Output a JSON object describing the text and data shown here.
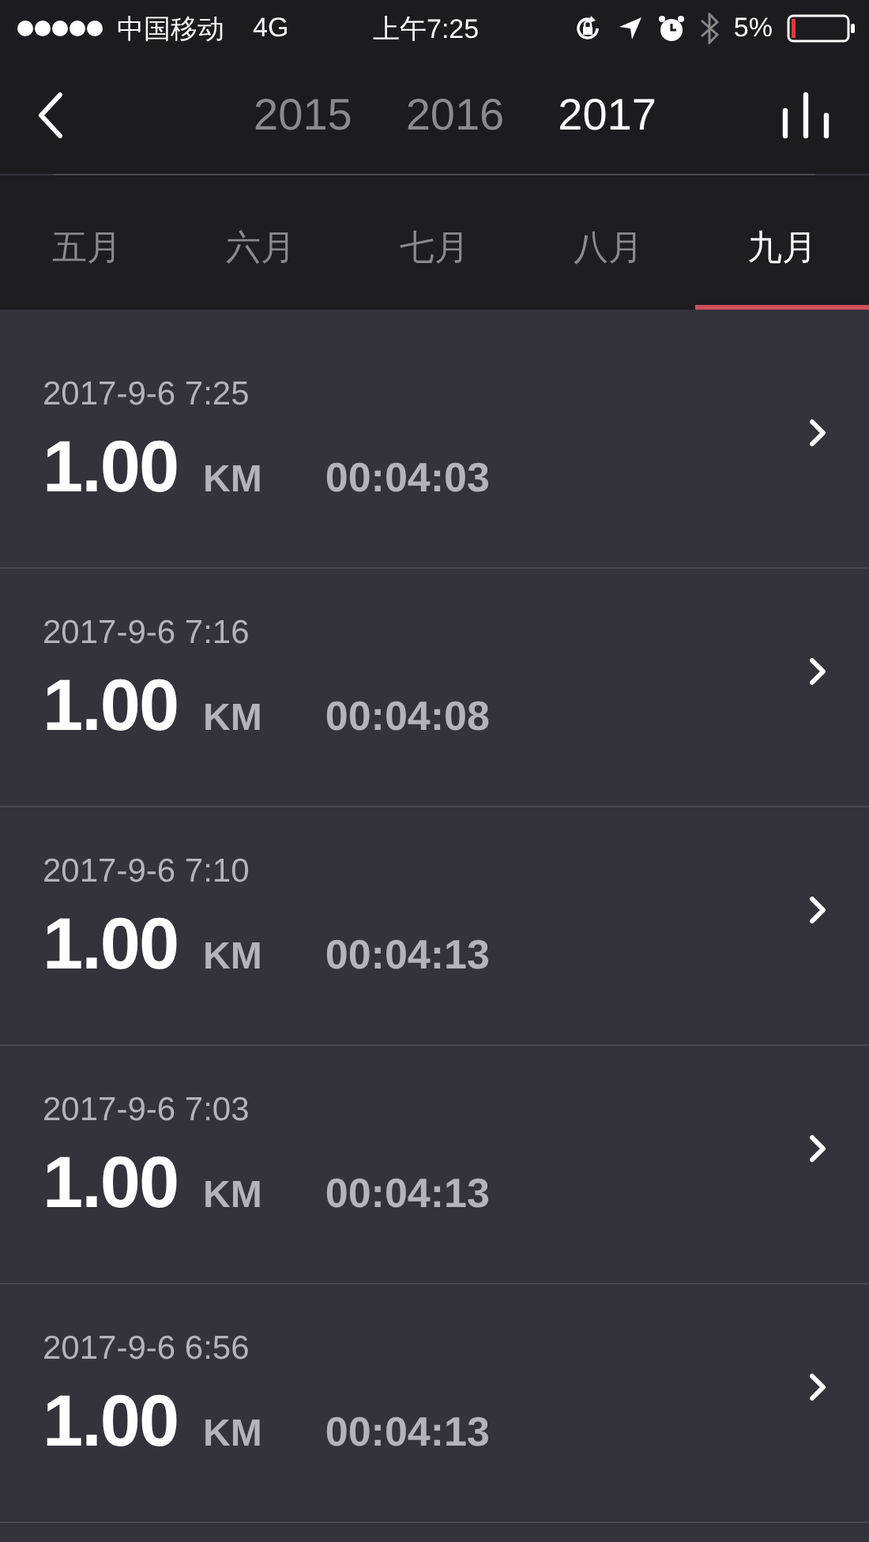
{
  "status_bar": {
    "carrier": "中国移动",
    "network": "4G",
    "time": "上午7:25",
    "battery": "5%"
  },
  "years": [
    {
      "label": "2015",
      "selected": false
    },
    {
      "label": "2016",
      "selected": false
    },
    {
      "label": "2017",
      "selected": true
    }
  ],
  "months": [
    {
      "label": "五月",
      "selected": false
    },
    {
      "label": "六月",
      "selected": false
    },
    {
      "label": "七月",
      "selected": false
    },
    {
      "label": "八月",
      "selected": false
    },
    {
      "label": "九月",
      "selected": true
    }
  ],
  "records": [
    {
      "date": "2017-9-6 7:25",
      "distance": "1.00",
      "unit": "KM",
      "duration": "00:04:03"
    },
    {
      "date": "2017-9-6 7:16",
      "distance": "1.00",
      "unit": "KM",
      "duration": "00:04:08"
    },
    {
      "date": "2017-9-6 7:10",
      "distance": "1.00",
      "unit": "KM",
      "duration": "00:04:13"
    },
    {
      "date": "2017-9-6 7:03",
      "distance": "1.00",
      "unit": "KM",
      "duration": "00:04:13"
    },
    {
      "date": "2017-9-6 6:56",
      "distance": "1.00",
      "unit": "KM",
      "duration": "00:04:13"
    }
  ]
}
